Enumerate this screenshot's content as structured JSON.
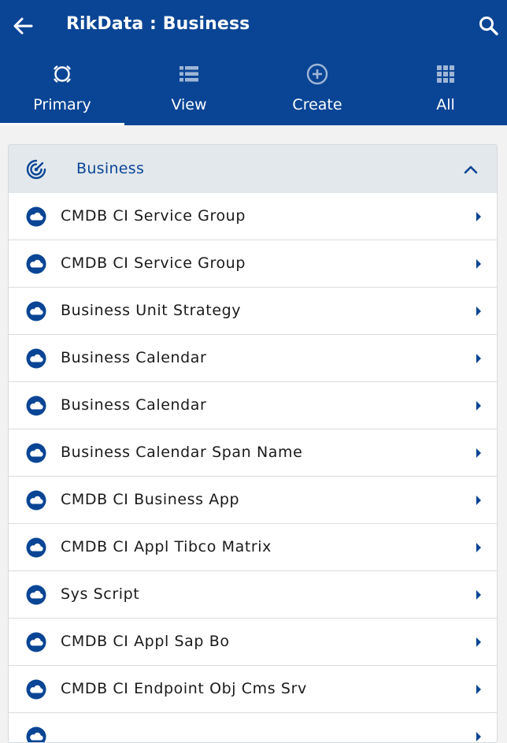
{
  "header": {
    "title": "RikData : Business",
    "back_icon": "arrow-left-icon",
    "search_icon": "search-icon"
  },
  "tabs": [
    {
      "label": "Primary",
      "icon": "target-ring-icon",
      "active": true
    },
    {
      "label": "View",
      "icon": "list-view-icon",
      "active": false
    },
    {
      "label": "Create",
      "icon": "plus-circle-icon",
      "active": false
    },
    {
      "label": "All",
      "icon": "grid-icon",
      "active": false
    }
  ],
  "section": {
    "title": "Business",
    "icon": "radar-icon",
    "expanded": true
  },
  "items": [
    {
      "label": "CMDB CI Service Group"
    },
    {
      "label": "CMDB CI Service Group"
    },
    {
      "label": "Business Unit Strategy"
    },
    {
      "label": "Business Calendar"
    },
    {
      "label": "Business Calendar"
    },
    {
      "label": "Business Calendar Span Name"
    },
    {
      "label": "CMDB CI Business App"
    },
    {
      "label": "CMDB CI Appl Tibco Matrix"
    },
    {
      "label": "Sys Script"
    },
    {
      "label": "CMDB CI Appl Sap Bo"
    },
    {
      "label": "CMDB CI Endpoint Obj Cms Srv"
    },
    {
      "label": ""
    }
  ],
  "colors": {
    "brand": "#0a4595",
    "section_bg": "#e3e8ec",
    "text": "#1a1a1a"
  }
}
